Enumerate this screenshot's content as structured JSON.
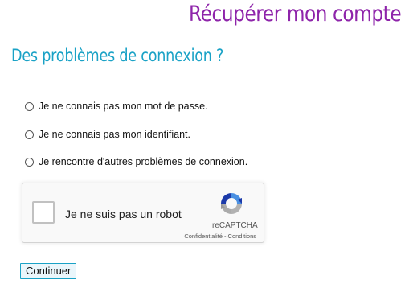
{
  "header": {
    "title": "Récupérer mon compte",
    "subtitle": "Des problèmes de connexion ?"
  },
  "options": [
    {
      "label": "Je ne connais pas mon mot de passe."
    },
    {
      "label": "Je ne connais pas mon identifiant."
    },
    {
      "label": "Je rencontre d'autres problèmes de connexion."
    }
  ],
  "captcha": {
    "label": "Je ne suis pas un robot",
    "brand": "reCAPTCHA",
    "privacy": "Confidentialité",
    "separator": " - ",
    "terms": "Conditions"
  },
  "actions": {
    "continue_label": "Continuer"
  },
  "colors": {
    "title": "#8e24aa",
    "subtitle": "#1aa2c6",
    "button_border": "#1aa2c6"
  }
}
